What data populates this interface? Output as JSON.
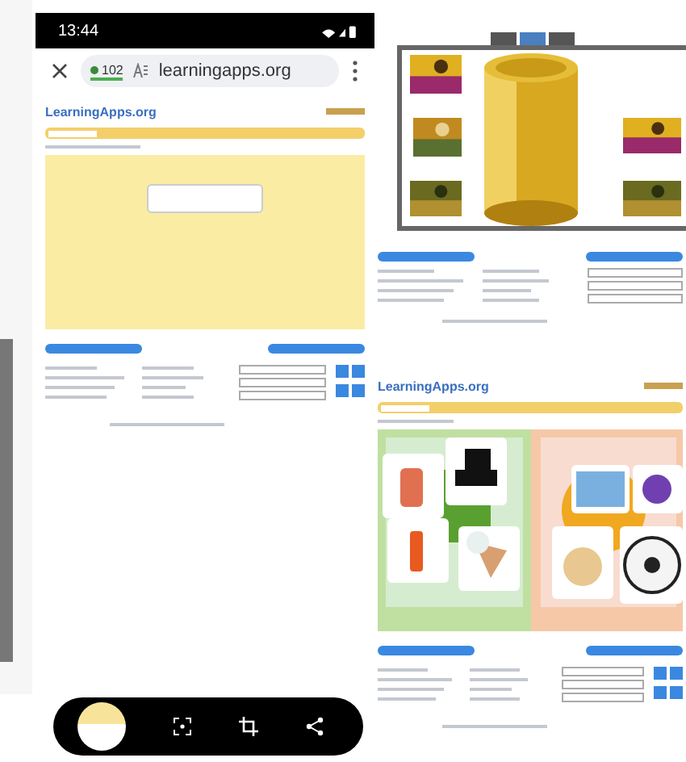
{
  "status_bar": {
    "time": "13:44"
  },
  "browser": {
    "tab_count": "102",
    "url": "learningapps.org"
  },
  "pages": [
    {
      "logo": "LearningApps.org"
    },
    {
      "logo": "LearningApps.org"
    }
  ]
}
